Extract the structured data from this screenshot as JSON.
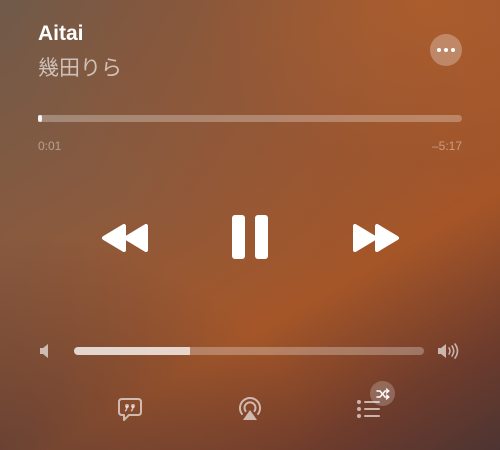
{
  "song": {
    "title": "Aitai",
    "artist": "幾田りら"
  },
  "playback": {
    "elapsed": "0:01",
    "remaining": "–5:17",
    "progress_fraction": 0.005
  },
  "volume": {
    "level_fraction": 0.33
  },
  "icons": {
    "more": "ellipsis-icon",
    "rewind": "rewind-icon",
    "pause": "pause-icon",
    "fast_forward": "fast-forward-icon",
    "volume_low": "volume-low-icon",
    "volume_high": "volume-high-icon",
    "lyrics": "lyrics-quote-icon",
    "airplay": "airplay-icon",
    "queue": "queue-list-icon",
    "shuffle": "shuffle-icon"
  },
  "colors": {
    "accent_orange": "#a55628",
    "foreground": "#ffffff"
  }
}
